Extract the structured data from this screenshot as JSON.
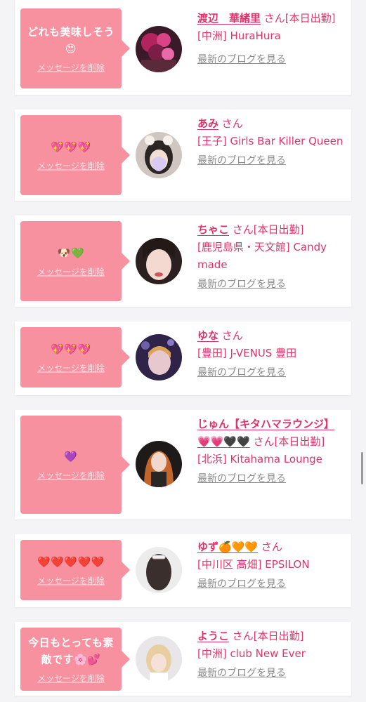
{
  "items": [
    {
      "message": "どれも美味しそう😍",
      "delete_label": "メッセージを削除",
      "name": "渡辺　華緒里",
      "suffix": "さん[本日出勤]",
      "shop": "[中洲] HuraHura",
      "blog_label": "最新のブログを見る"
    },
    {
      "message": "💖💖💖",
      "delete_label": "メッセージを削除",
      "name": "あみ",
      "suffix": "さん",
      "shop": "[王子] Girls Bar Killer Queen",
      "blog_label": "最新のブログを見る"
    },
    {
      "message": "🐶💚",
      "delete_label": "メッセージを削除",
      "name": "ちゃこ",
      "suffix": "さん[本日出勤]",
      "shop": "[鹿児島県・天文館] Candy made",
      "blog_label": "最新のブログを見る"
    },
    {
      "message": "💖💖💖",
      "delete_label": "メッセージを削除",
      "name": "ゆな",
      "suffix": "さん",
      "shop": "[豊田] J-VENUS 豊田",
      "blog_label": "最新のブログを見る"
    },
    {
      "message": "💜",
      "delete_label": "メッセージを削除",
      "name": "じゅん【キタハマラウンジ】💗💗🖤🖤",
      "suffix": "さん[本日出勤]",
      "shop": "[北浜] Kitahama Lounge",
      "blog_label": "最新のブログを見る"
    },
    {
      "message": "❤️❤️❤️❤️❤️",
      "delete_label": "メッセージを削除",
      "name": "ゆず🍊🧡🧡",
      "suffix": "さん",
      "shop": "[中川区 高畑] EPSILON",
      "blog_label": "最新のブログを見る"
    },
    {
      "message": "今日もとっても素敵です🌸💕",
      "delete_label": "メッセージを削除",
      "name": "ようこ",
      "suffix": "さん[本日出勤]",
      "shop": "[中洲] club New Ever",
      "blog_label": "最新のブログを見る"
    }
  ],
  "colors": {
    "accent": "#e0336b",
    "bubble": "#f7909f",
    "link_gray": "#8b8b8b",
    "background": "#f4f4f6"
  }
}
